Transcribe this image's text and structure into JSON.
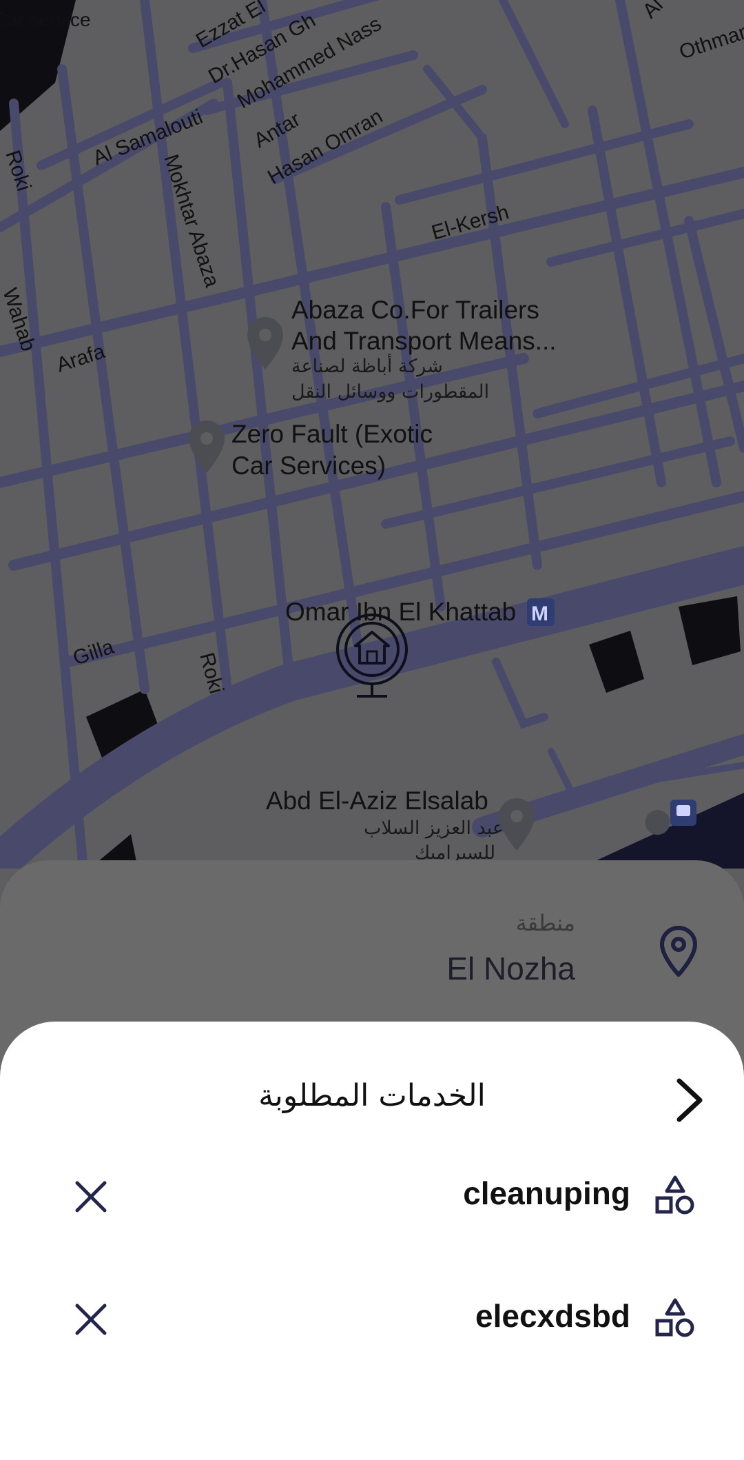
{
  "map": {
    "labels": {
      "service_fragment": "Car service",
      "ezzat": "Ezzat El",
      "dr_hasan": "Dr.Hasan Gh",
      "mohammed_nass": "Mohammed Nass",
      "othman": "Othman",
      "al_top": "Al",
      "antar": "Antar",
      "hasan_omran": "Hasan Omran",
      "al_samalouti": "Al Samalouti",
      "roki_1": "Roki",
      "mokhtar_abaza": "Mokhtar Abaza",
      "el_kersh": "El-Kersh",
      "wahab": "Wahab",
      "arafa": "Arafa",
      "gilla": "Gilla",
      "roki_2": "Roki"
    },
    "places": {
      "abaza_line1": "Abaza Co.For Trailers",
      "abaza_line2": "And Transport Means...",
      "abaza_ar_line1": "شركة أباظة لصناعة",
      "abaza_ar_line2": "المقطورات ووسائل النقل",
      "zero_line1": "Zero Fault (Exotic",
      "zero_line2": "Car Services)",
      "omar_station": "Omar Ibn El Khattab",
      "metro_badge": "M",
      "abd_line1": "Abd El-Aziz Elsalab",
      "abd_ar_line1": "عبد العزيز السلاب",
      "abd_ar_line2": "للسيراميك"
    }
  },
  "location": {
    "label": "منطقة",
    "value": "El Nozha"
  },
  "sheet": {
    "title": "الخدمات المطلوبة",
    "services": [
      {
        "name": "cleanuping"
      },
      {
        "name": "elecxdsbd"
      }
    ]
  },
  "colors": {
    "road": "#494a6b",
    "map_bg": "#5e5e60",
    "accent_icon": "#23254a",
    "sheet_bg": "#ffffff"
  }
}
